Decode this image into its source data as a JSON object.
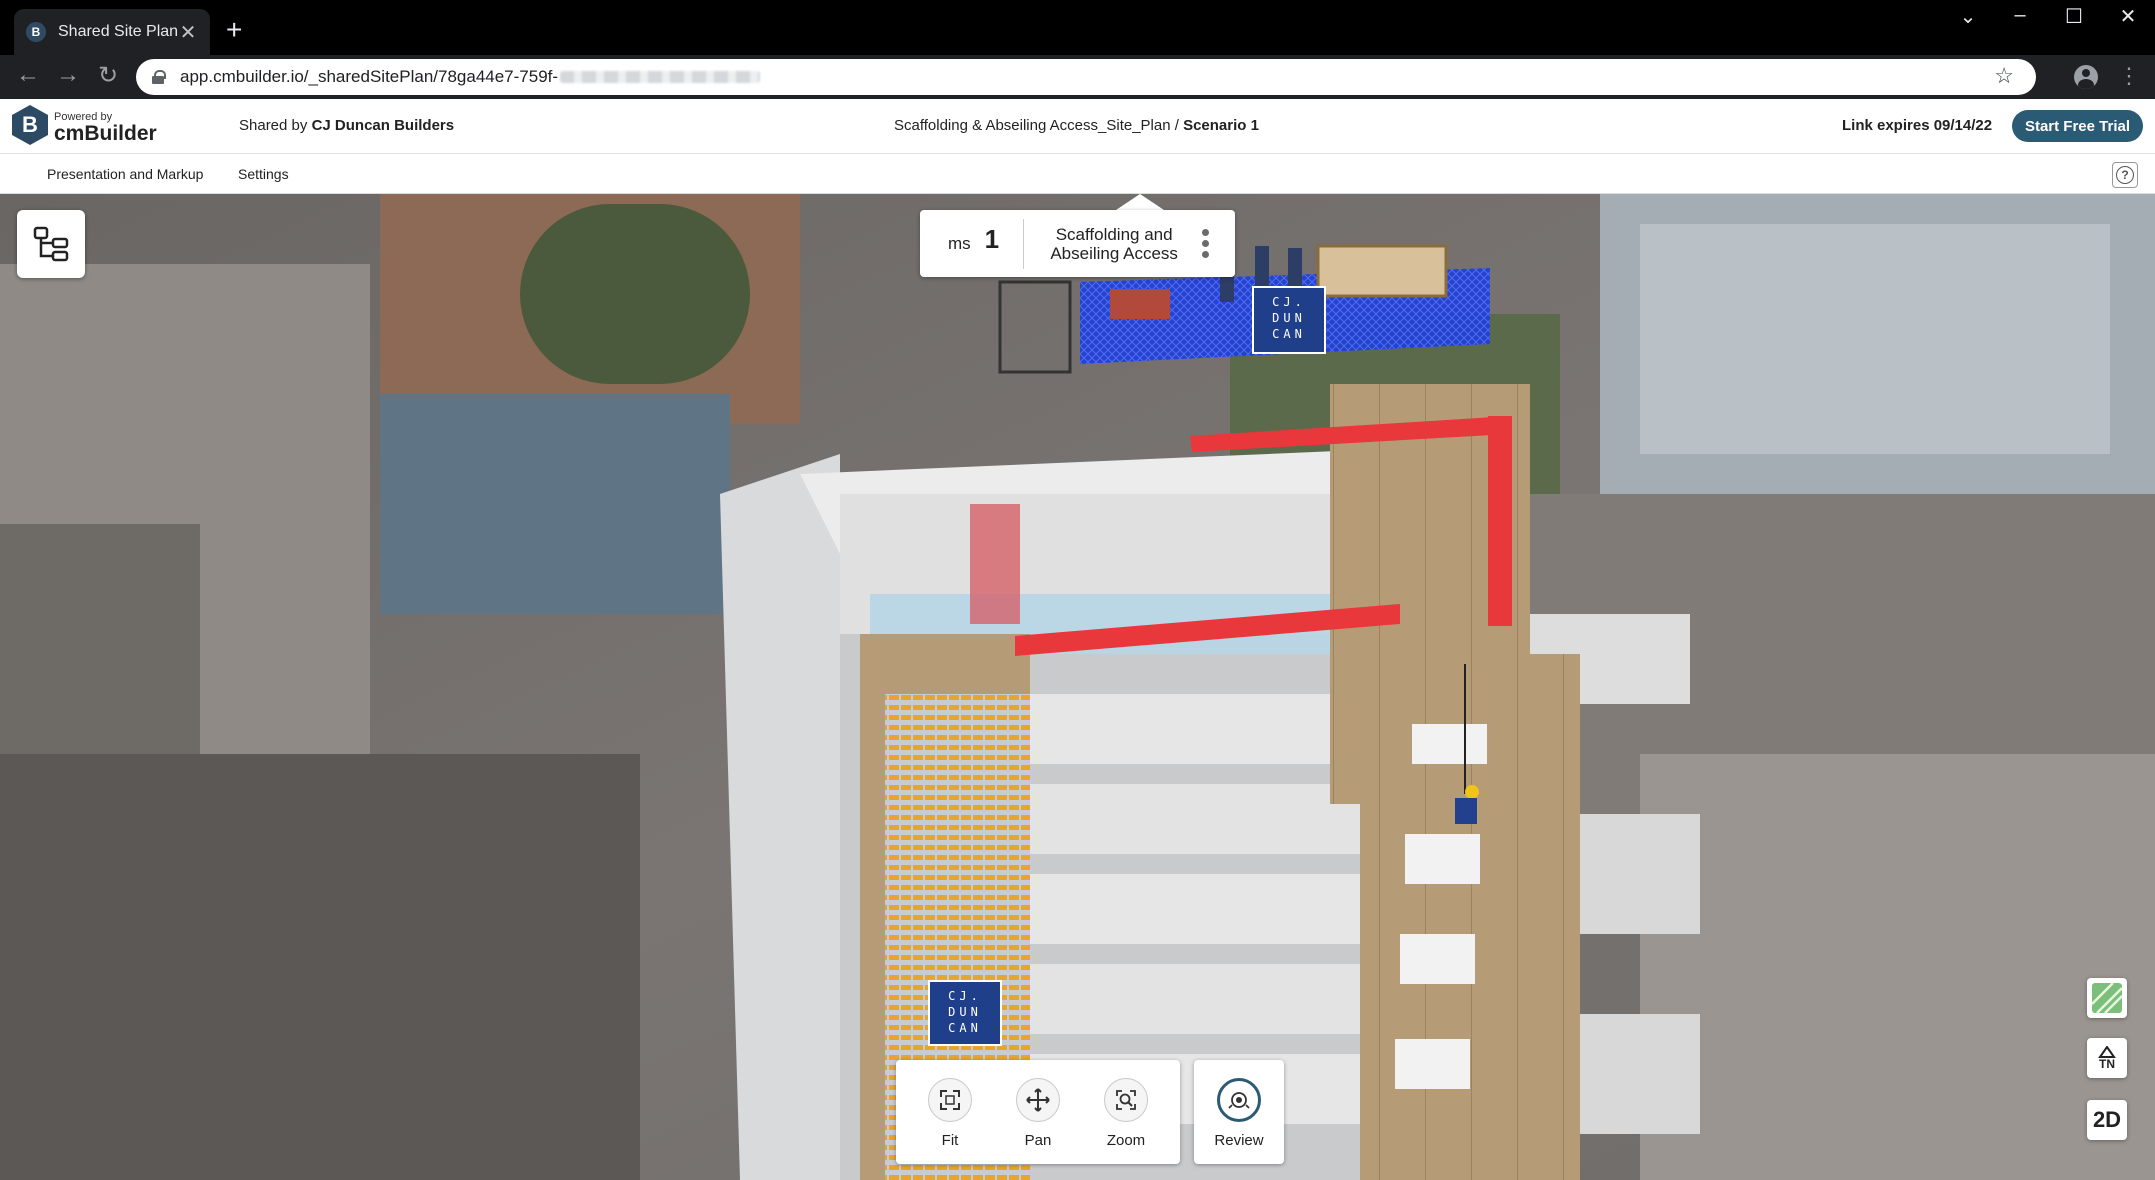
{
  "browser": {
    "tab_title": "Shared Site Plans -",
    "favicon": "B",
    "url": "app.cmbuilder.io/_sharedSitePlan/78ga44e7-759f-"
  },
  "header": {
    "powered_by": "Powered by",
    "brand": "cmBuilder",
    "logo_letter": "B",
    "shared_by_prefix": "Shared by",
    "shared_by_name": "CJ Duncan Builders",
    "plan_name": "Scaffolding & Abseiling Access_Site_Plan /",
    "scenario": "Scenario 1",
    "link_expires": "Link expires 09/14/22",
    "trial_button": "Start Free Trial"
  },
  "tabs": [
    {
      "label": "Presentation and Markup"
    },
    {
      "label": "Settings"
    }
  ],
  "help_label": "?",
  "scenario_card": {
    "prefix": "ms",
    "number": "1",
    "name_line1": "Scaffolding and",
    "name_line2": "Abseiling Access"
  },
  "tools": {
    "fit": "Fit",
    "pan": "Pan",
    "zoom": "Zoom",
    "review": "Review"
  },
  "side": {
    "tn": "TN",
    "view2d": "2D"
  },
  "signage": {
    "line1": "CJ.",
    "line2": "DUN",
    "line3": "CAN"
  },
  "colors": {
    "accent": "#2b5b74",
    "brand": "#2c4a63",
    "scaffold_mesh": "#1e3fd6",
    "edge_protection": "#e8383b",
    "timber_cladding": "#b59c76"
  }
}
